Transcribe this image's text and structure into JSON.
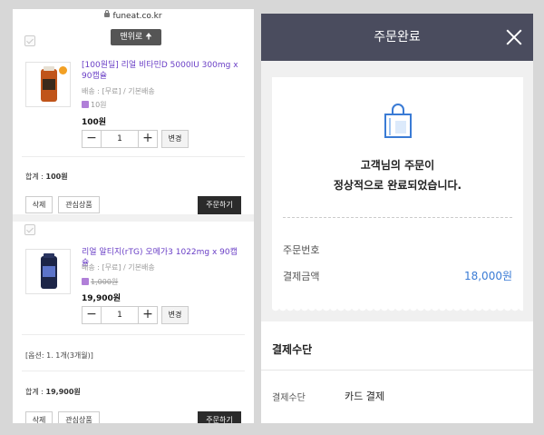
{
  "browser": {
    "url": "funeat.co.kr"
  },
  "scroll_top_button": {
    "label": "맨위로",
    "arrow": "🠉"
  },
  "cart_items": [
    {
      "name": "[100원딜] 리얼 비타민D 5000IU 300mg x 90캡슐",
      "shipping": "배송 : [무료] / 기본배송",
      "points": "10원",
      "price": "100원",
      "quantity": "1",
      "change_label": "변경",
      "total_label": "합계 : ",
      "total_value": "100원",
      "delete_label": "삭제",
      "wishlist_label": "관심상품",
      "order_label": "주문하기"
    },
    {
      "name": "리얼 알티지(rTG) 오메가3 1022mg x 90캡슐",
      "shipping": "배송 : [무료] / 기본배송",
      "points": "1,000원",
      "price": "19,900원",
      "quantity": "1",
      "change_label": "변경",
      "option": "[옵션: 1. 1개(3개월)]",
      "total_label": "합계 : ",
      "total_value": "19,900원",
      "delete_label": "삭제",
      "wishlist_label": "관심상품",
      "order_label": "주문하기"
    }
  ],
  "order_complete": {
    "header_title": "주문완료",
    "message_line1": "고객님의 주문이",
    "message_line2": "정상적으로 완료되었습니다.",
    "order_number_label": "주문번호",
    "order_number_value": "",
    "amount_label": "결제금액",
    "amount_value": "18,000원",
    "payment_section_title": "결제수단",
    "payment_method_label": "결제수단",
    "payment_method_value": "카드 결제"
  },
  "colors": {
    "header_bg": "#4a4c5e",
    "amount_blue": "#3a7bd5",
    "product_name_purple": "#6a3fc6",
    "order_button": "#2b2b2b"
  }
}
